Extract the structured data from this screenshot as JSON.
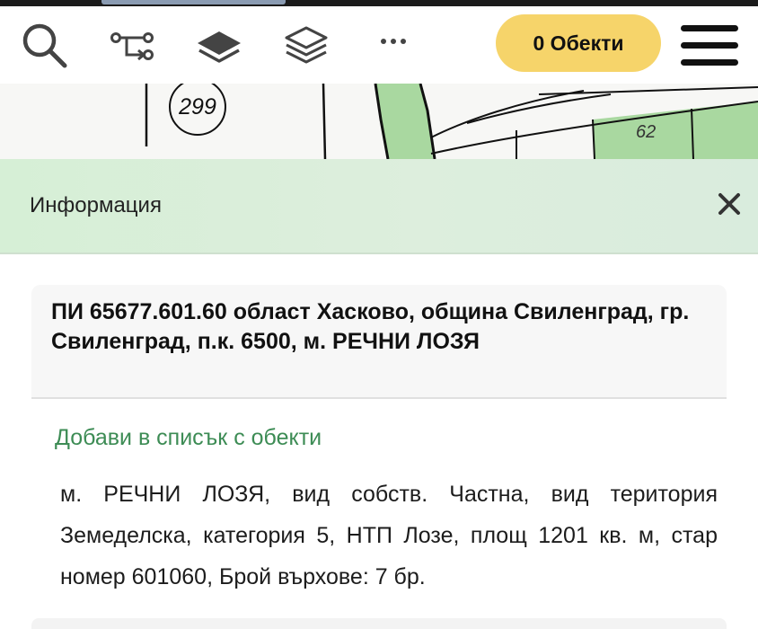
{
  "toolbar": {
    "icons": [
      "search-icon",
      "route-icon",
      "layer-icon",
      "layers-stack-icon",
      "more-icon",
      "menu-icon"
    ],
    "objects_button": "0 Обекти"
  },
  "map": {
    "parcel_numbers": [
      "299",
      "62"
    ],
    "colors": {
      "vineyard_green": "#a9d8a0",
      "background": "#f6f6f6",
      "line": "#111111"
    }
  },
  "info_panel": {
    "title": "Информация",
    "close_icon": "close-icon"
  },
  "parcel": {
    "title": "ПИ 65677.601.60 област Хасково, община Свиленград, гр. Свиленград, п.к. 6500, м. РЕЧНИ ЛОЗЯ",
    "add_link": "Добави в списък с обекти",
    "details": "м. РЕЧНИ ЛОЗЯ, вид собств. Частна, вид територия Земеделска, категория 5, НТП Лозе, площ 1201 кв. м, стар номер 601060, Брой върхове: 7 бр."
  },
  "colors": {
    "accent_button": "#f6d46a",
    "link_green": "#3d8c55",
    "header_green": "#d6efd6"
  }
}
